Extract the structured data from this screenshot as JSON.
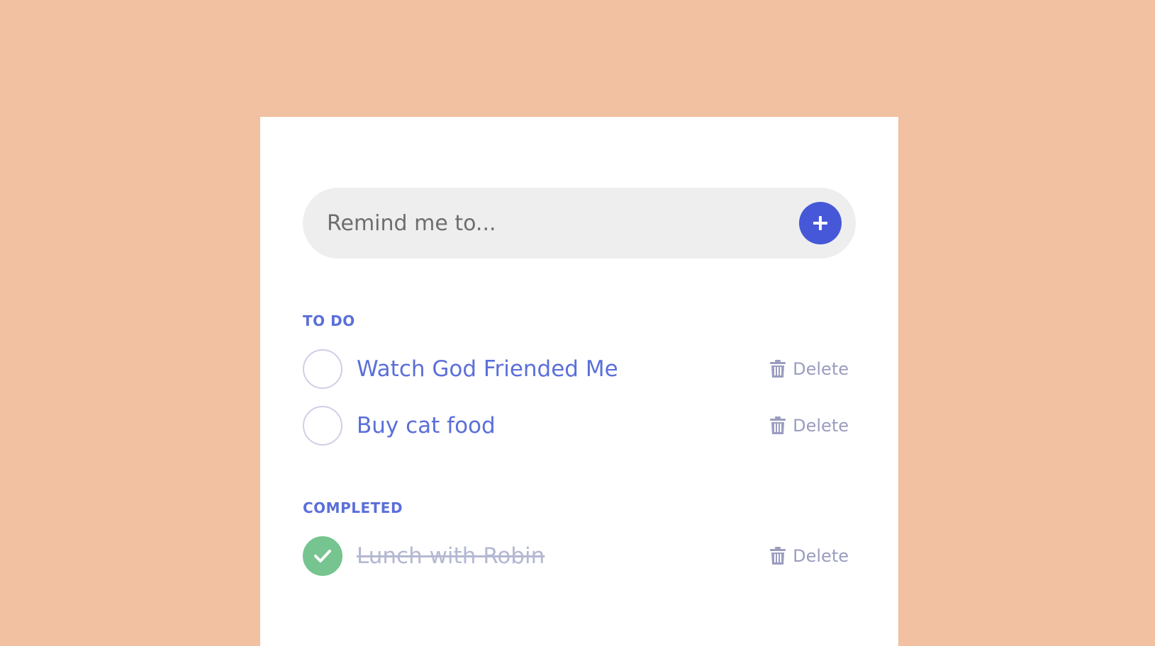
{
  "input": {
    "placeholder": "Remind me to..."
  },
  "colors": {
    "background": "#f1c1a1",
    "accent": "#4658d8",
    "text": "#5b6fd9",
    "done": "#76c48f"
  },
  "sections": {
    "todo": {
      "title": "TO DO",
      "items": [
        {
          "text": "Watch God Friended Me",
          "delete_label": "Delete"
        },
        {
          "text": "Buy cat food",
          "delete_label": "Delete"
        }
      ]
    },
    "completed": {
      "title": "COMPLETED",
      "items": [
        {
          "text": "Lunch with Robin",
          "delete_label": "Delete"
        }
      ]
    }
  },
  "icons": {
    "add": "plus-icon",
    "delete": "trash-icon",
    "checked": "checkmark-icon"
  }
}
